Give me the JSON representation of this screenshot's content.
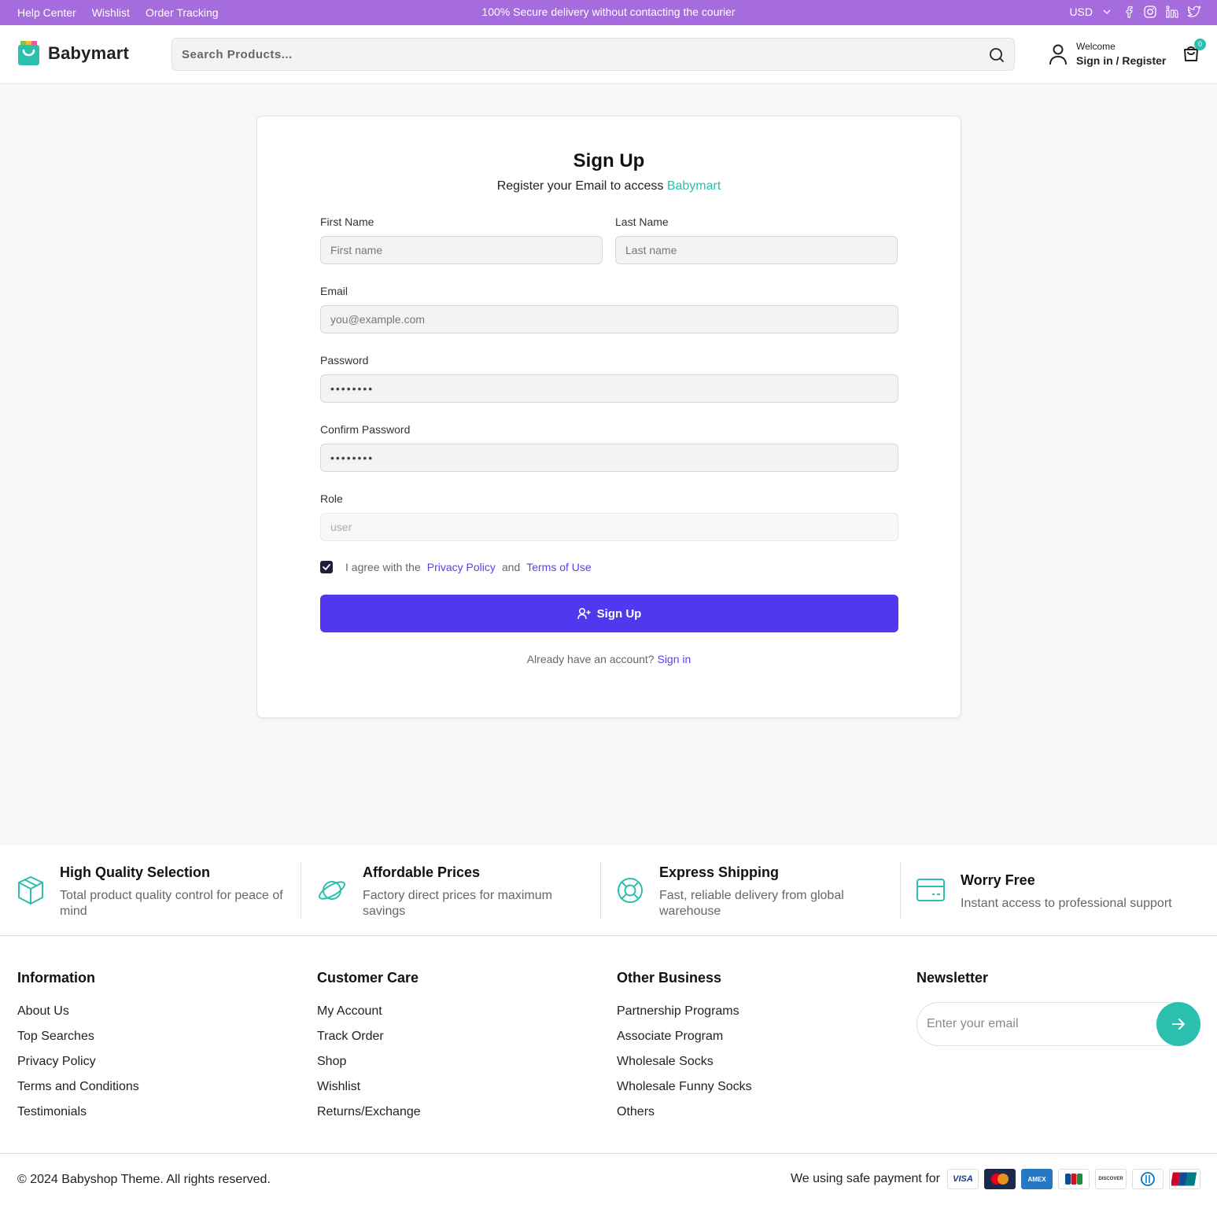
{
  "topbar": {
    "links": [
      "Help Center",
      "Wishlist",
      "Order Tracking"
    ],
    "promo": "100% Secure delivery without contacting the courier",
    "currency": "USD",
    "social_icons": [
      "facebook-icon",
      "instagram-icon",
      "linkedin-icon",
      "twitter-icon"
    ]
  },
  "header": {
    "logo_text": "Babymart",
    "search_placeholder": "Search Products...",
    "account_welcome": "Welcome",
    "account_signin": "Sign in / Register",
    "cart_count": "0"
  },
  "signup": {
    "title": "Sign Up",
    "subtitle_prefix": "Register your Email to access",
    "subtitle_brand": "Babymart",
    "first_name_label": "First Name",
    "first_name_placeholder": "First name",
    "last_name_label": "Last Name",
    "last_name_placeholder": "Last name",
    "email_label": "Email",
    "email_placeholder": "you@example.com",
    "password_label": "Password",
    "password_value": "••••••••",
    "confirm_label": "Confirm Password",
    "confirm_value": "••••••••",
    "role_label": "Role",
    "role_value": "user",
    "agree_prefix": "I agree with the",
    "privacy_link": "Privacy Policy",
    "agree_and": "and",
    "terms_link": "Terms of Use",
    "agree_checked": true,
    "submit_label": "Sign Up",
    "already_text": "Already have an account?",
    "signin_link": "Sign in"
  },
  "features": [
    {
      "title": "High Quality Selection",
      "desc": "Total product quality control for peace of mind",
      "icon": "box-icon"
    },
    {
      "title": "Affordable Prices",
      "desc": "Factory direct prices for maximum savings",
      "icon": "planet-icon"
    },
    {
      "title": "Express Shipping",
      "desc": "Fast, reliable delivery from global warehouse",
      "icon": "lifebuoy-icon"
    },
    {
      "title": "Worry Free",
      "desc": "Instant access to professional support",
      "icon": "credit-card-icon"
    }
  ],
  "footer": {
    "information": {
      "title": "Information",
      "items": [
        "About Us",
        "Top Searches",
        "Privacy Policy",
        "Terms and Conditions",
        "Testimonials"
      ]
    },
    "customer_care": {
      "title": "Customer Care",
      "items": [
        "My Account",
        "Track Order",
        "Shop",
        "Wishlist",
        "Returns/Exchange"
      ]
    },
    "other_business": {
      "title": "Other Business",
      "items": [
        "Partnership Programs",
        "Associate Program",
        "Wholesale Socks",
        "Wholesale Funny Socks",
        "Others"
      ]
    },
    "newsletter": {
      "title": "Newsletter",
      "placeholder": "Enter your email"
    },
    "copyright": "© 2024 Babyshop Theme. All rights reserved.",
    "payment_text": "We using safe payment for",
    "payment_cards": [
      "VISA",
      "Mastercard",
      "AMEX",
      "JCB",
      "DISCOVER",
      "Diners",
      "UnionPay"
    ]
  },
  "colors": {
    "topbar": "#a66bdc",
    "accent_teal": "#2bbfb0",
    "primary_button": "#5138ee",
    "link": "#5a3ee6"
  }
}
